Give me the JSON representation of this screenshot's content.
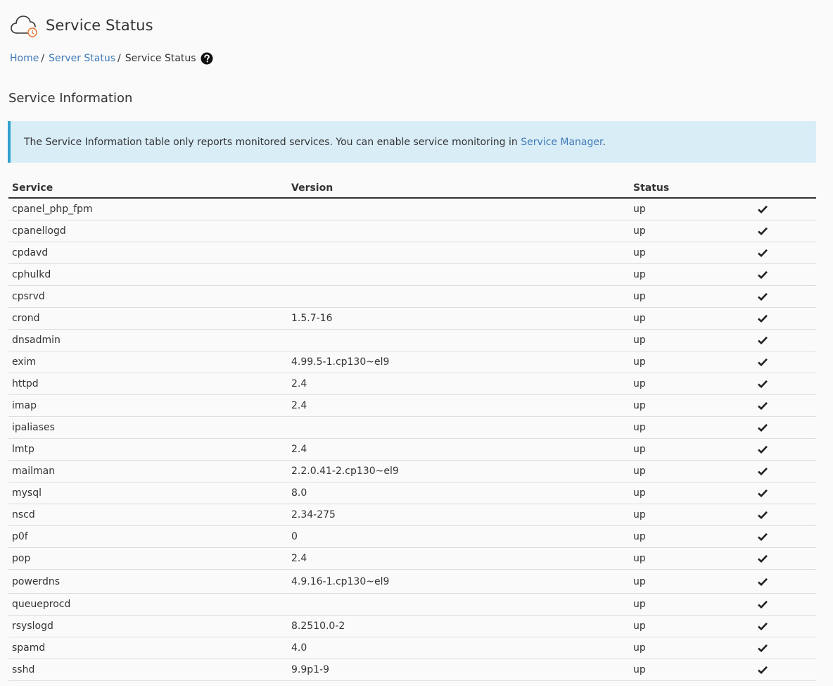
{
  "header": {
    "title": "Service Status",
    "icon": "cloud-clock-icon",
    "accent_color": "#e8712c"
  },
  "breadcrumb": {
    "home": "Home",
    "sep1": "/",
    "server_status": "Server Status",
    "sep2": "/",
    "current": "Service Status",
    "help_icon": "question-circle-icon"
  },
  "section": {
    "title": "Service Information"
  },
  "info": {
    "text": "The Service Information table only reports monitored services. You can enable service monitoring in ",
    "link": "Service Manager",
    "suffix": "."
  },
  "table": {
    "headers": {
      "service": "Service",
      "version": "Version",
      "status": "Status"
    },
    "rows": [
      {
        "service": "cpanel_php_fpm",
        "version": "",
        "status": "up"
      },
      {
        "service": "cpanellogd",
        "version": "",
        "status": "up"
      },
      {
        "service": "cpdavd",
        "version": "",
        "status": "up"
      },
      {
        "service": "cphulkd",
        "version": "",
        "status": "up"
      },
      {
        "service": "cpsrvd",
        "version": "",
        "status": "up"
      },
      {
        "service": "crond",
        "version": "1.5.7-16",
        "status": "up"
      },
      {
        "service": "dnsadmin",
        "version": "",
        "status": "up"
      },
      {
        "service": "exim",
        "version": "4.99.5-1.cp130~el9",
        "status": "up"
      },
      {
        "service": "httpd",
        "version": "2.4",
        "status": "up"
      },
      {
        "service": "imap",
        "version": "2.4",
        "status": "up"
      },
      {
        "service": "ipaliases",
        "version": "",
        "status": "up"
      },
      {
        "service": "lmtp",
        "version": "2.4",
        "status": "up"
      },
      {
        "service": "mailman",
        "version": "2.2.0.41-2.cp130~el9",
        "status": "up"
      },
      {
        "service": "mysql",
        "version": "8.0",
        "status": "up"
      },
      {
        "service": "nscd",
        "version": "2.34-275",
        "status": "up"
      },
      {
        "service": "p0f",
        "version": "0",
        "status": "up"
      },
      {
        "service": "pop",
        "version": "2.4",
        "status": "up"
      },
      {
        "service": "powerdns",
        "version": "4.9.16-1.cp130~el9",
        "status": "up"
      },
      {
        "service": "queueprocd",
        "version": "",
        "status": "up"
      },
      {
        "service": "rsyslogd",
        "version": "8.2510.0-2",
        "status": "up"
      },
      {
        "service": "spamd",
        "version": "4.0",
        "status": "up"
      },
      {
        "service": "sshd",
        "version": "9.9p1-9",
        "status": "up"
      }
    ],
    "status_icon": "check-icon"
  },
  "colors": {
    "link": "#3f7ab8",
    "info_bg": "#d9edf7",
    "info_border": "#31a1cf",
    "text": "#333333"
  }
}
